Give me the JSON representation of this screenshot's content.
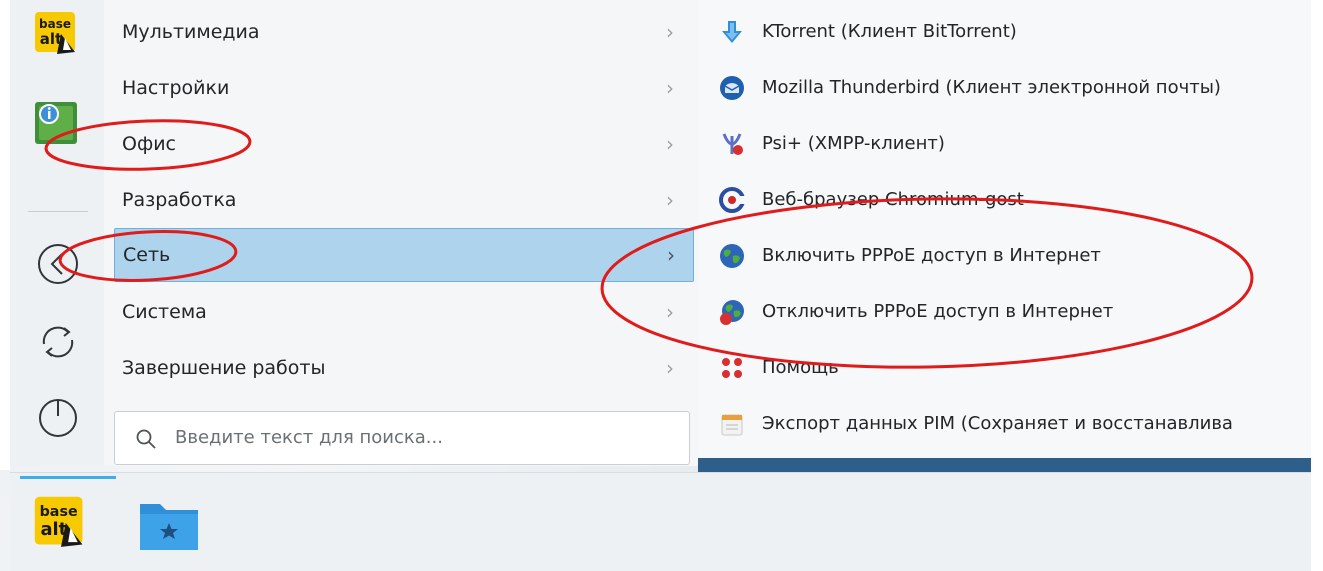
{
  "favorites": {
    "logo_text_top": "base",
    "logo_text_bottom": "alt",
    "info_icon": "info-icon",
    "leave_icon": "leave-icon",
    "refresh_icon": "refresh-icon",
    "power_icon": "power-icon"
  },
  "categories": [
    {
      "label": "Мультимедиа",
      "active": false
    },
    {
      "label": "Настройки",
      "active": false
    },
    {
      "label": "Офис",
      "active": false
    },
    {
      "label": "Разработка",
      "active": false
    },
    {
      "label": "Сеть",
      "active": true
    },
    {
      "label": "Система",
      "active": false
    },
    {
      "label": "Завершение работы",
      "active": false
    }
  ],
  "search": {
    "placeholder": "Введите текст для поиска..."
  },
  "apps": [
    {
      "label": "KTorrent (Клиент BitTorrent)",
      "icon": "ktorrent-icon"
    },
    {
      "label": "Mozilla Thunderbird (Клиент электронной почты)",
      "icon": "thunderbird-icon"
    },
    {
      "label": "Psi+ (XMPP-клиент)",
      "icon": "psi-icon"
    },
    {
      "label": "Веб-браузер Chromium-gost",
      "icon": "chromium-icon"
    },
    {
      "label": "Включить PPPoE доступ в Интернет",
      "icon": "globe-icon"
    },
    {
      "label": "Отключить PPPoE доступ в Интернет",
      "icon": "globe-disconnect-icon"
    },
    {
      "label": "Помощь",
      "icon": "help-icon"
    },
    {
      "label": "Экспорт данных PIM (Сохраняет и восстанавлива",
      "icon": "pim-export-icon"
    }
  ],
  "taskbar": {
    "logo_text_top": "base",
    "logo_text_bottom": "alt",
    "folder_icon": "folder-favorites-icon"
  },
  "colors": {
    "highlight": "#aed3ec",
    "annotation": "#e01b1b",
    "accent": "#3daee9"
  }
}
